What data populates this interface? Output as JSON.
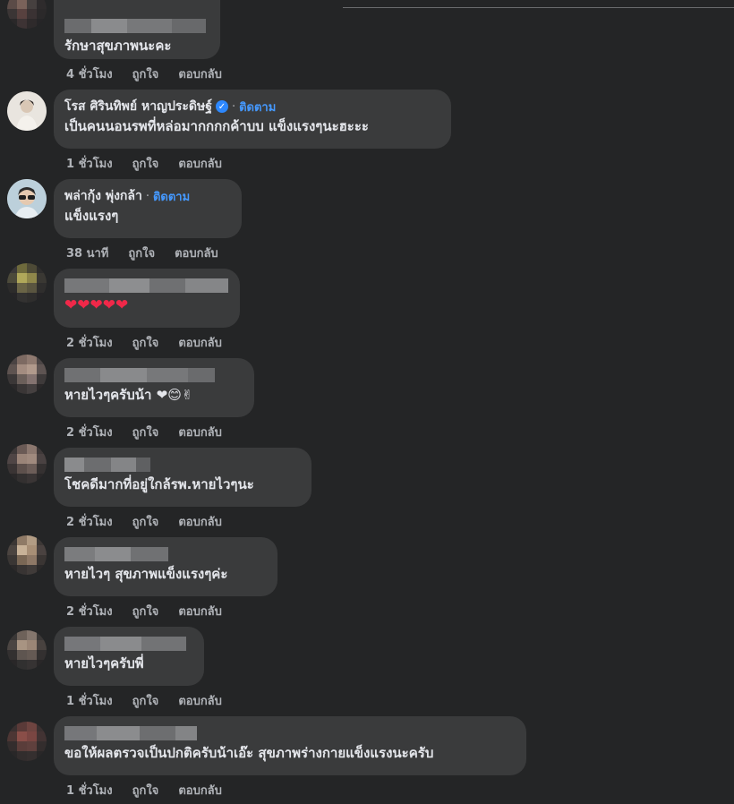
{
  "labels": {
    "like": "ถูกใจ",
    "reply": "ตอบกลับ",
    "follow": "ติดตาม",
    "separator": "·"
  },
  "comments": [
    {
      "name": "",
      "text": "รักษาสุขภาพนะคะ",
      "time": "4 ชั่วโมง"
    },
    {
      "name": "โรส ศิรินทิพย์ หาญประดิษฐ์",
      "verified": true,
      "follow": true,
      "text": "เป็นคนนอนรพที่หล่อมากกกกค้าบบ แข็งแรงๆนะฮะะะ",
      "time": "1 ชั่วโมง"
    },
    {
      "name": "พล่ากุ้ง พุ่งกล้า",
      "follow": true,
      "text": "แข็งแรงๆ",
      "time": "38 นาที"
    },
    {
      "name": "",
      "text": "❤❤❤❤❤",
      "time": "2 ชั่วโมง"
    },
    {
      "name": "",
      "text": "หายไวๆครับน้า ❤😊✌",
      "time": "2 ชั่วโมง"
    },
    {
      "name": "",
      "text": "โชคดีมากที่อยู่ใกล้รพ.หายไวๆนะ",
      "time": "2 ชั่วโมง"
    },
    {
      "name": "",
      "text": "หายไวๆ สุขภาพแข็งแรงๆค่ะ",
      "time": "2 ชั่วโมง"
    },
    {
      "name": "",
      "text": "หายไวๆครับพี่",
      "time": "1 ชั่วโมง"
    },
    {
      "name": "",
      "text": "ขอให้ผลตรวจเป็นปกติครับน้าเอ๊ะ สุขภาพร่างกายแข็งแรงนะครับ",
      "time": "1 ชั่วโมง"
    }
  ]
}
